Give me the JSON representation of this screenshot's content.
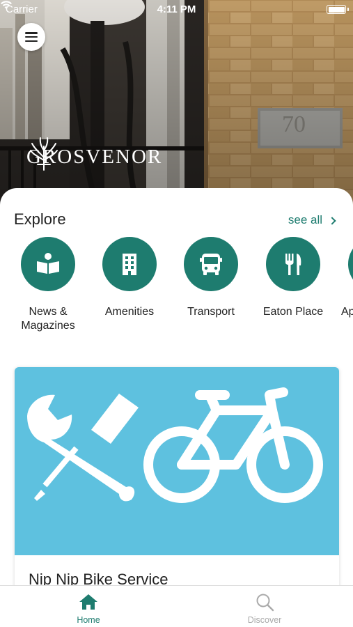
{
  "status_bar": {
    "carrier": "Carrier",
    "time": "4:11 PM",
    "wifi_icon": "wifi-icon",
    "battery_icon": "battery-icon"
  },
  "header": {
    "menu_icon": "hamburger-menu-icon",
    "brand_name": "GROSVENOR",
    "brand_logo_icon": "wheatsheaf-logo-icon",
    "hero_plaque_text": "70"
  },
  "explore": {
    "title": "Explore",
    "see_all_label": "see all",
    "categories": [
      {
        "label": "News & Magazines",
        "icon": "book-reader-icon"
      },
      {
        "label": "Amenities",
        "icon": "building-icon"
      },
      {
        "label": "Transport",
        "icon": "bus-icon"
      },
      {
        "label": "Eaton Place",
        "icon": "utensils-icon"
      },
      {
        "label": "Ap",
        "icon": "partial-category-icon"
      }
    ]
  },
  "featured_card": {
    "title": "Nip Nip Bike Service",
    "image_icons": [
      "wrench-screwdriver-icon",
      "bicycle-icon"
    ]
  },
  "tab_bar": {
    "tabs": [
      {
        "label": "Home",
        "icon": "home-icon",
        "active": true
      },
      {
        "label": "Discover",
        "icon": "search-icon",
        "active": false
      }
    ]
  },
  "colors": {
    "accent": "#1e7c6f",
    "card_image_bg": "#5ec1df",
    "inactive_tab": "#aaaaaa"
  }
}
